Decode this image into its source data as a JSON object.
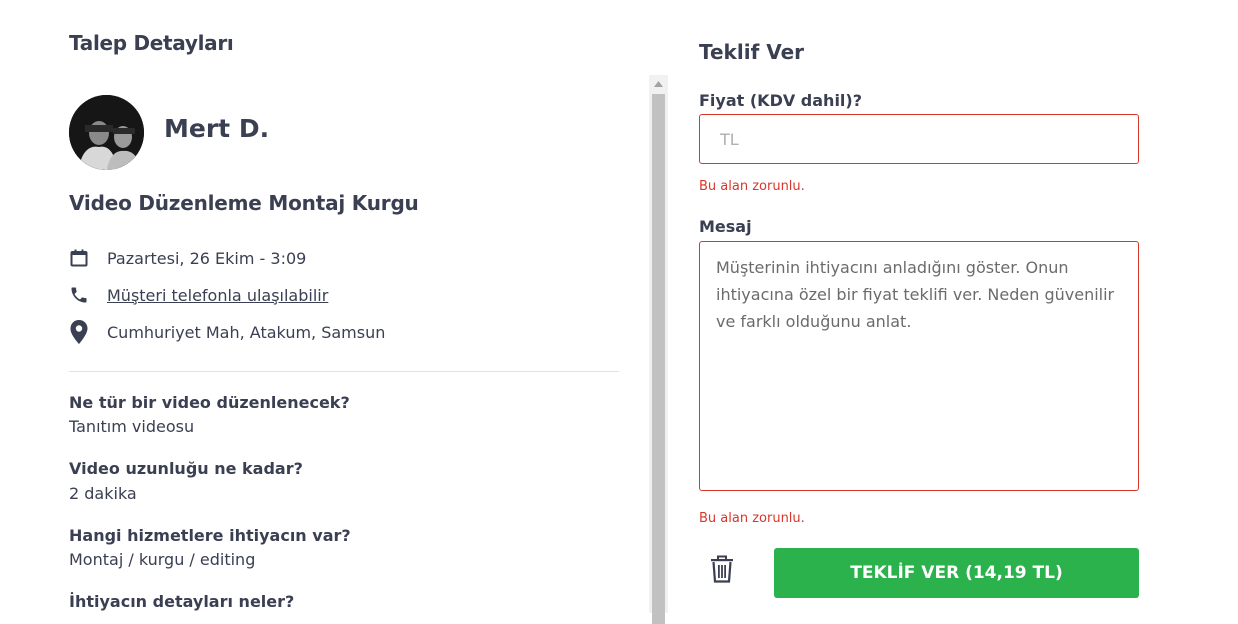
{
  "details": {
    "title": "Talep Detayları",
    "user_name": "Mert D.",
    "job_title": "Video Düzenleme Montaj Kurgu",
    "date": "Pazartesi, 26 Ekim - 3:09",
    "phone_text": "Müşteri telefonla ulaşılabilir",
    "location": "Cumhuriyet Mah, Atakum, Samsun",
    "qa": [
      {
        "question": "Ne tür bir video düzenlenecek?",
        "answer": "Tanıtım videosu"
      },
      {
        "question": "Video uzunluğu ne kadar?",
        "answer": "2 dakika"
      },
      {
        "question": "Hangi hizmetlere ihtiyacın var?",
        "answer": "Montaj / kurgu / editing"
      },
      {
        "question": "İhtiyacın detayları neler?",
        "answer": ""
      }
    ]
  },
  "offer": {
    "title": "Teklif Ver",
    "price_label": "Fiyat (KDV dahil)?",
    "price_placeholder": "TL",
    "price_value": "",
    "required_error": "Bu alan zorunlu.",
    "message_label": "Mesaj",
    "message_placeholder": "Müşterinin ihtiyacını anladığını göster. Onun ihtiyacına özel bir fiyat teklifi ver. Neden güvenilir ve farklı olduğunu anlat.",
    "message_value": "",
    "submit_label": "TEKLİF VER (14,19 TL)"
  },
  "icons": {
    "calendar": "calendar-icon",
    "phone": "phone-icon",
    "location": "location-pin-icon",
    "trash": "trash-icon"
  },
  "colors": {
    "text": "#3a3f52",
    "error": "#d9362c",
    "submit_bg": "#2bb24c",
    "divider": "#e2e2e2"
  }
}
